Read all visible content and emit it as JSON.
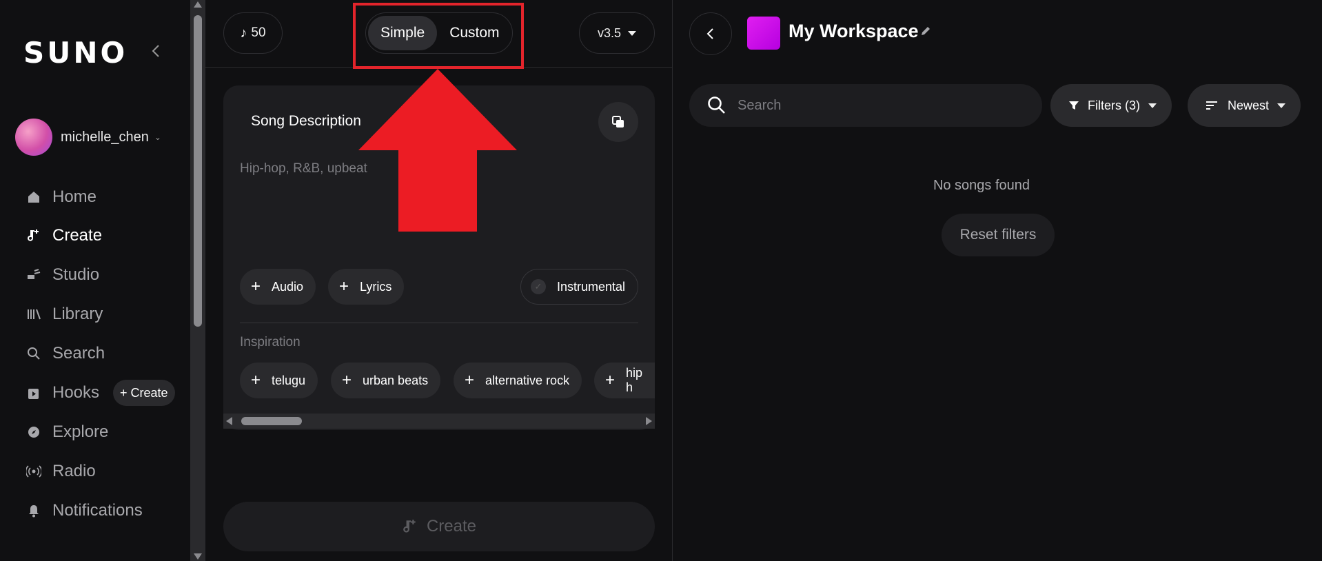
{
  "brand": {
    "logo": "SUNO"
  },
  "user": {
    "name": "michelle_chen"
  },
  "nav": [
    {
      "label": "Home",
      "icon": "home-icon"
    },
    {
      "label": "Create",
      "icon": "create-icon"
    },
    {
      "label": "Studio",
      "icon": "studio-icon"
    },
    {
      "label": "Library",
      "icon": "library-icon"
    },
    {
      "label": "Search",
      "icon": "search-icon"
    },
    {
      "label": "Hooks",
      "icon": "hooks-icon"
    },
    {
      "label": "Explore",
      "icon": "explore-icon"
    },
    {
      "label": "Radio",
      "icon": "radio-icon"
    },
    {
      "label": "Notifications",
      "icon": "bell-icon"
    }
  ],
  "hooks_create": "+ Create",
  "topbar": {
    "credits": "50",
    "mode_simple": "Simple",
    "mode_custom": "Custom",
    "version": "v3.5"
  },
  "song": {
    "title": "Song Description",
    "placeholder": "Hip-hop, R&B, upbeat",
    "audio": "Audio",
    "lyrics": "Lyrics",
    "instrumental": "Instrumental",
    "inspiration_label": "Inspiration",
    "inspirations": [
      "telugu",
      "urban beats",
      "alternative rock",
      "hip h"
    ]
  },
  "create_button": "Create",
  "workspace": {
    "title": "My Workspace",
    "search_placeholder": "Search",
    "filters": "Filters (3)",
    "sort": "Newest",
    "empty": "No songs found",
    "reset": "Reset filters"
  },
  "colors": {
    "accent_highlight": "#e3242b",
    "workspace_thumb": "#d40ff0"
  }
}
